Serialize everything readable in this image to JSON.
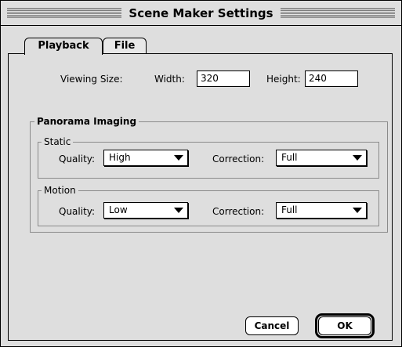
{
  "window": {
    "title": "Scene Maker Settings"
  },
  "tabs": [
    {
      "label": "Playback",
      "active": true
    },
    {
      "label": "File",
      "active": false
    }
  ],
  "viewing_size": {
    "label": "Viewing Size:",
    "width_label": "Width:",
    "width_value": "320",
    "height_label": "Height:",
    "height_value": "240"
  },
  "panorama": {
    "title": "Panorama Imaging",
    "static": {
      "title": "Static",
      "quality_label": "Quality:",
      "quality_value": "High",
      "correction_label": "Correction:",
      "correction_value": "Full"
    },
    "motion": {
      "title": "Motion",
      "quality_label": "Quality:",
      "quality_value": "Low",
      "correction_label": "Correction:",
      "correction_value": "Full"
    }
  },
  "buttons": {
    "cancel": "Cancel",
    "ok": "OK"
  }
}
